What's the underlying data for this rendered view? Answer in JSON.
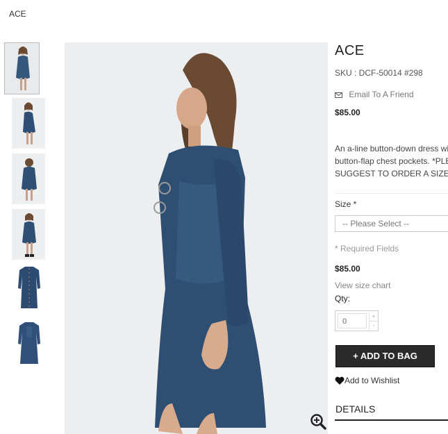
{
  "breadcrumb": "ACE",
  "product": {
    "title": "ACE",
    "sku": "SKU : DCF-50014 #298",
    "email_friend": "Email To A Friend",
    "price": "$85.00",
    "description_line1": "An a-line button-down dress wi",
    "description_line2": "button-flap chest pockets. *PLE",
    "description_line3": "SUGGEST TO ORDER A SIZE",
    "size_label": "Size *",
    "size_placeholder": "-- Please Select --",
    "required_note": "* Required Fields",
    "price_again": "$85.00",
    "size_chart_link": "View size chart",
    "qty_label": "Qty:",
    "qty_value": "0",
    "add_to_bag": "ADD TO BAG",
    "add_to_bag_icon": "+",
    "wishlist": "Add to Wishlist",
    "details_tab": "DETAILS"
  },
  "icons": {
    "email": "envelope-icon",
    "wishlist": "heart-icon",
    "zoom": "zoom-in-icon",
    "qty_up": "chevron-up-icon",
    "qty_down": "chevron-down-icon"
  },
  "colors": {
    "denim": "#2f4f72",
    "button_bg": "#2b2b2b",
    "image_bg": "#eceef0"
  }
}
